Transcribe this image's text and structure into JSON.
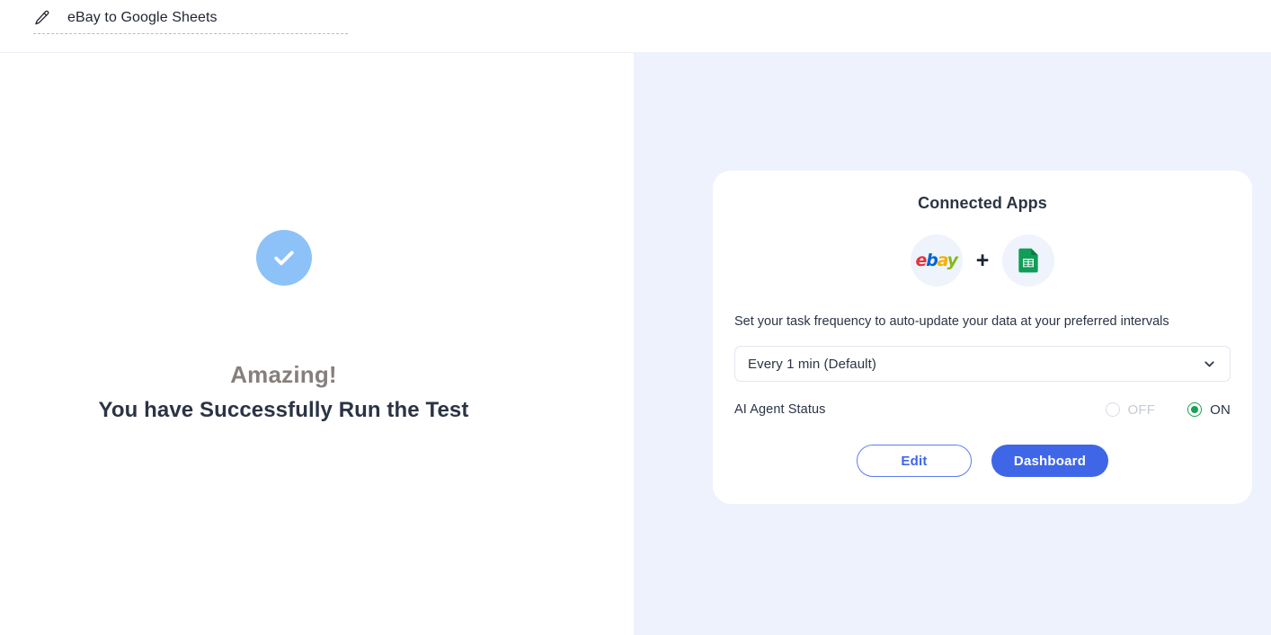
{
  "header": {
    "edit_icon": "pencil-icon",
    "doc_title": "eBay to Google Sheets"
  },
  "left": {
    "status_icon": "check-circle-icon",
    "headline": "Amazing!",
    "subheadline": "You have Successfully Run the Test"
  },
  "card": {
    "title": "Connected Apps",
    "apps": [
      {
        "name": "eBay",
        "icon": "ebay-icon"
      },
      {
        "name": "Google Sheets",
        "icon": "google-sheets-icon"
      }
    ],
    "connector": "+",
    "frequency_description": "Set your task frequency to auto-update your data at your preferred intervals",
    "frequency_select": {
      "value": "Every 1 min (Default)",
      "chevron": "chevron-down-icon"
    },
    "status": {
      "label": "AI Agent Status",
      "options": [
        {
          "label": "OFF",
          "selected": false
        },
        {
          "label": "ON",
          "selected": true
        }
      ]
    },
    "buttons": {
      "edit": "Edit",
      "dashboard": "Dashboard"
    }
  },
  "colors": {
    "accent_blue": "#4066e8",
    "panel_bg": "#eef2fd",
    "success_circle": "#8dc2f8",
    "on_green": "#1aa251",
    "headline_gray": "#877f7c",
    "text_dark": "#2b3445"
  }
}
